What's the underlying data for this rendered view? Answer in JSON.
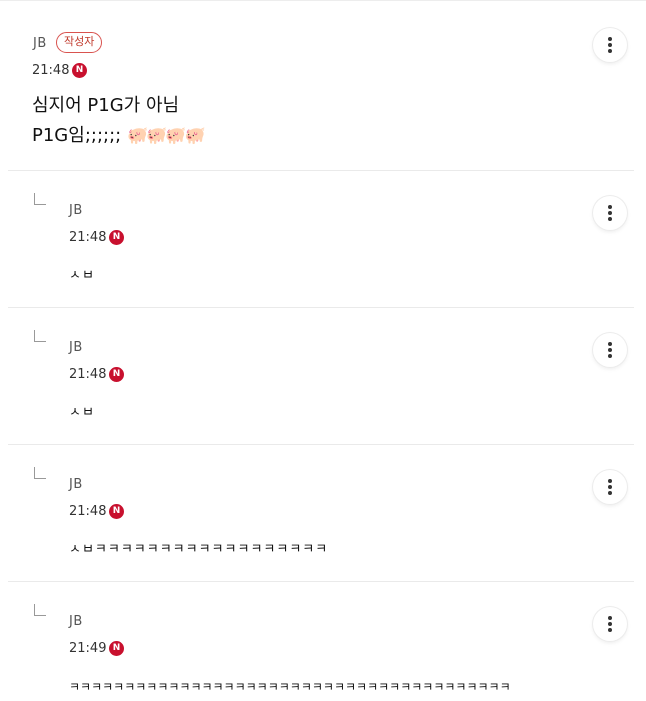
{
  "comments": [
    {
      "author": "JB",
      "badge": "작성자",
      "time": "21:48",
      "n": "N",
      "line1": "심지어 P1G가 아님",
      "line2": "P1G임;;;;;;",
      "emoji": "🐖🐖🐖🐖"
    },
    {
      "author": "JB",
      "time": "21:48",
      "n": "N",
      "text": "ㅅㅂ"
    },
    {
      "author": "JB",
      "time": "21:48",
      "n": "N",
      "text": "ㅅㅂ"
    },
    {
      "author": "JB",
      "time": "21:48",
      "n": "N",
      "text": "ㅅㅂㅋㅋㅋㅋㅋㅋㅋㅋㅋㅋㅋㅋㅋㅋㅋㅋㅋㅋ"
    },
    {
      "author": "JB",
      "time": "21:49",
      "n": "N",
      "text": "ㅋㅋㅋㅋㅋㅋㅋㅋㅋㅋㅋㅋㅋㅋㅋㅋㅋㅋㅋㅋㅋㅋㅋㅋㅋㅋㅋㅋㅋㅋㅋㅋㅋㅋㅋㅋㅋㅋㅋㅋ"
    }
  ],
  "icons": {
    "menu": "more-vertical-icon",
    "reply": "reply-arrow-icon",
    "new": "new-badge-icon"
  }
}
